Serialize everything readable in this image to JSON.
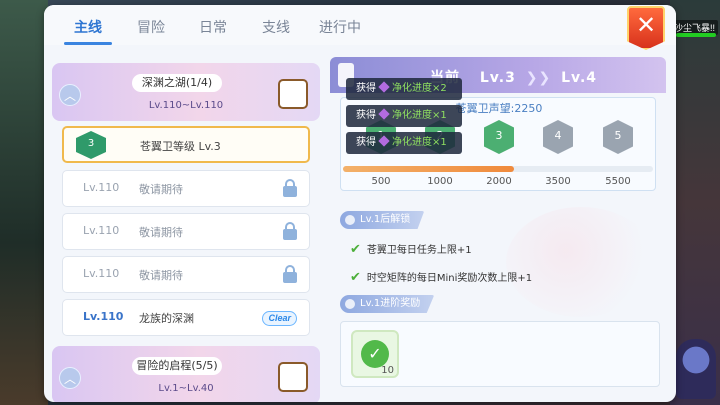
{
  "hud": {
    "player_label": "沙尘飞暴!!"
  },
  "tabs": [
    {
      "label": "主线",
      "active": true
    },
    {
      "label": "冒险",
      "active": false
    },
    {
      "label": "日常",
      "active": false
    },
    {
      "label": "支线",
      "active": false
    },
    {
      "label": "进行中",
      "active": false
    }
  ],
  "close_button": {
    "icon": "close-x-icon",
    "glyph": "✕"
  },
  "groups": [
    {
      "title": "深渊之湖(1/4)",
      "range": "Lv.110~Lv.110"
    },
    {
      "title": "冒险的启程(5/5)",
      "range": "Lv.1~Lv.40"
    }
  ],
  "quests": [
    {
      "badge": "3",
      "lv": "",
      "name": "苍翼卫等级 Lv.3",
      "status": "selected"
    },
    {
      "lv": "Lv.110",
      "name": "敬请期待",
      "status": "locked"
    },
    {
      "lv": "Lv.110",
      "name": "敬请期待",
      "status": "locked"
    },
    {
      "lv": "Lv.110",
      "name": "敬请期待",
      "status": "locked"
    },
    {
      "lv": "Lv.110",
      "name": "龙族的深渊",
      "status": "clear",
      "badge_text": "Clear"
    }
  ],
  "level": {
    "current_label": "当前",
    "current": "Lv.3",
    "next": "Lv.4"
  },
  "reputation": {
    "title": "苍翼卫声望:2250",
    "progress_fraction": 0.55,
    "nodes": [
      {
        "num": "1",
        "threshold": "500",
        "done": true
      },
      {
        "num": "2",
        "threshold": "1000",
        "done": true
      },
      {
        "num": "3",
        "threshold": "2000",
        "done": true
      },
      {
        "num": "4",
        "threshold": "3500",
        "done": false
      },
      {
        "num": "5",
        "threshold": "5500",
        "done": false
      }
    ]
  },
  "unlock": {
    "label": "Lv.1后解锁",
    "perks": [
      "苍翼卫每日任务上限+1",
      "时空矩阵的每日Mini奖励次数上限+1"
    ]
  },
  "rewards": {
    "label": "Lv.1进阶奖励",
    "qty": "10"
  },
  "tooltips": [
    {
      "prefix": "获得",
      "item": "净化进度×2"
    },
    {
      "prefix": "获得",
      "item": "净化进度×1"
    },
    {
      "prefix": "获得",
      "item": "净化进度×1"
    }
  ]
}
